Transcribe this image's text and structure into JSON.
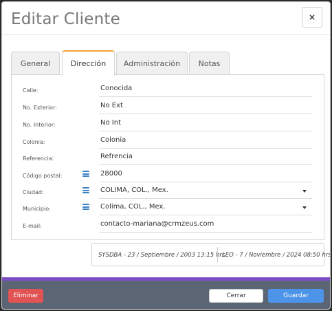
{
  "dialog": {
    "title": "Editar Cliente",
    "close_label": "×"
  },
  "tabs": [
    {
      "label": "General"
    },
    {
      "label": "Dirección"
    },
    {
      "label": "Administración"
    },
    {
      "label": "Notas"
    }
  ],
  "active_tab": "Dirección",
  "fields": {
    "calle": {
      "label": "Calle:",
      "value": "Conocida"
    },
    "no_exterior": {
      "label": "No. Exterior:",
      "value": "No Ext"
    },
    "no_interior": {
      "label": "No. Interior:",
      "value": "No Int"
    },
    "colonia": {
      "label": "Colonia:",
      "value": "Colonia"
    },
    "referencia": {
      "label": "Referencia:",
      "value": "Refrencia"
    },
    "codigo_postal": {
      "label": "Código postal:",
      "value": "28000"
    },
    "ciudad": {
      "label": "Ciudad:",
      "value": "COLIMA, COL., Mex."
    },
    "municipio": {
      "label": "Municipio:",
      "value": "Colima, COL., Mex."
    },
    "email": {
      "label": "E-mail:",
      "value": "contacto-mariana@crmzeus.com"
    }
  },
  "audit": {
    "created": "SYSDBA - 23 / Septiembre / 2003 13:15 hrs.",
    "modified": "LEO - 7 / Noviembre / 2024 08:50 hrs."
  },
  "footer": {
    "delete_label": "Eliminar",
    "close_label": "Cerrar",
    "save_label": "Guardar"
  },
  "colors": {
    "active_tab_accent": "#f2a33a",
    "purple_bar": "#7c4fc4",
    "footer_bg": "#5b6573",
    "delete": "#e25353",
    "save": "#4d94e8",
    "menu_icon": "#3b82c6"
  },
  "icons": [
    "close-icon",
    "menu-icon",
    "chevron-down-icon"
  ]
}
